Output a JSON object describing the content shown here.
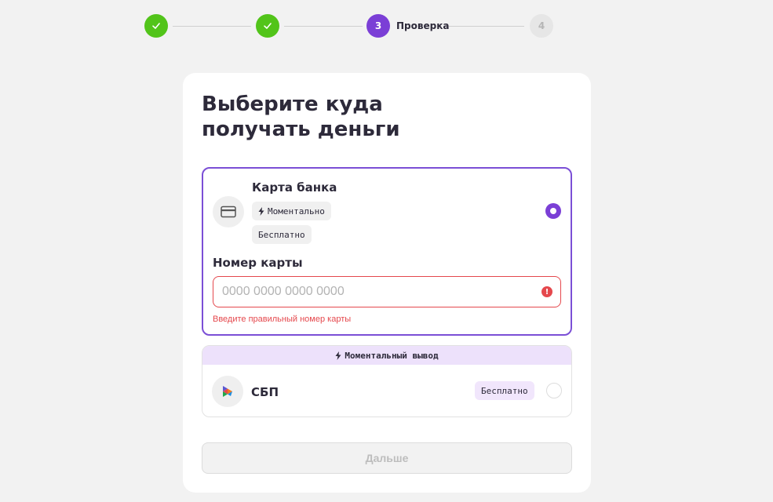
{
  "stepper": {
    "steps": [
      {
        "state": "done",
        "icon": "check-icon"
      },
      {
        "state": "done",
        "icon": "check-icon"
      },
      {
        "state": "active",
        "number": "3",
        "label": "Проверка"
      },
      {
        "state": "future",
        "number": "4"
      }
    ],
    "colors": {
      "done": "#52c41a",
      "active": "#7b3fd6",
      "future": "#e6e6e6"
    }
  },
  "card": {
    "title_line1": "Выберите куда",
    "title_line2": "получать деньги"
  },
  "bank_card_option": {
    "title": "Карта банка",
    "icon": "credit-card-icon",
    "badge_instant": "Моментально",
    "badge_free": "Бесплатно",
    "selected": true,
    "field_label": "Номер карты",
    "field_value": "",
    "field_placeholder": "0000 0000 0000 0000",
    "error_icon_symbol": "!",
    "error_text": "Введите правильный номер карты"
  },
  "sbp_option": {
    "banner": "Моментальный вывод",
    "title": "СБП",
    "icon": "sbp-logo-icon",
    "badge_free": "Бесплатно",
    "selected": false
  },
  "next_button": {
    "label": "Дальше",
    "disabled": true
  },
  "colors": {
    "accent": "#7b3fd6",
    "error": "#e5484d",
    "success": "#52c41a",
    "banner_bg": "#ede1fb"
  }
}
